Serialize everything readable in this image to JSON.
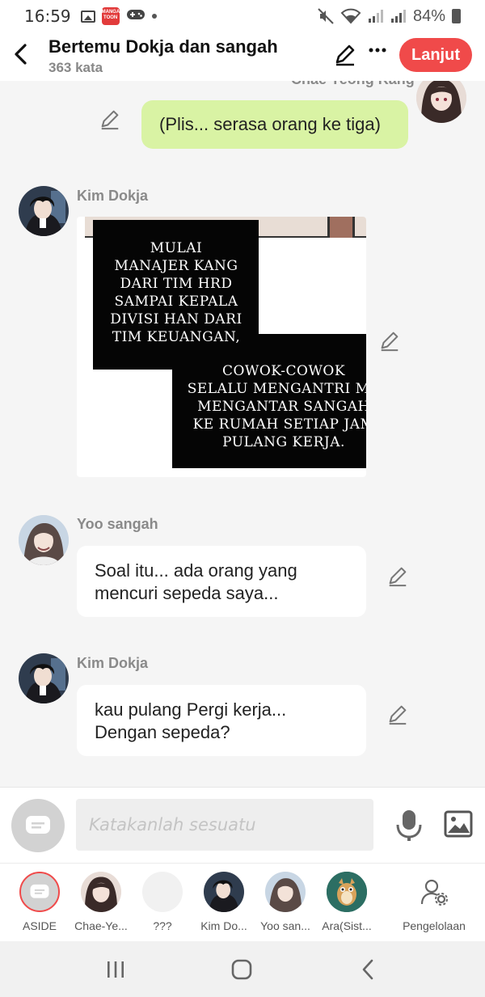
{
  "status_bar": {
    "time": "16:59",
    "manga_badge": "MANGA TOON",
    "battery": "84%"
  },
  "header": {
    "title": "Bertemu Dokja dan sangah",
    "word_count": "363 kata",
    "next_label": "Lanjut"
  },
  "chat": {
    "cut_speaker": "Chae Yeong Kang",
    "messages": [
      {
        "type": "mine",
        "text": "(Plis... serasa orang ke tiga)"
      },
      {
        "type": "image",
        "speaker": "Kim Dokja",
        "panel_text_1": "MULAI\nMANAJER KANG\nDARI TIM HRD\nSAMPAI KEPALA\nDIVISI HAN DARI\nTIM KEUANGAN,",
        "panel_text_2": "COWOK-COWOK\nSELALU MENGANTRI MA\nMENGANTAR SANGAH\nKE RUMAH SETIAP JAM\nPULANG KERJA."
      },
      {
        "type": "text",
        "speaker": "Yoo sangah",
        "text": "Soal itu... ada orang yang mencuri sepeda saya..."
      },
      {
        "type": "text",
        "speaker": "Kim Dokja",
        "text": "kau pulang Pergi kerja... Dengan sepeda?"
      }
    ]
  },
  "input": {
    "placeholder": "Katakanlah sesuatu"
  },
  "characters": [
    {
      "label": "ASIDE"
    },
    {
      "label": "Chae-Ye..."
    },
    {
      "label": "???"
    },
    {
      "label": "Kim Do..."
    },
    {
      "label": "Yoo san..."
    },
    {
      "label": "Ara(Sist..."
    },
    {
      "label": "Pengelolaan"
    }
  ],
  "colors": {
    "accent": "#f04a4a",
    "my_bubble": "#d9f3a4",
    "background": "#f5f5f5"
  }
}
